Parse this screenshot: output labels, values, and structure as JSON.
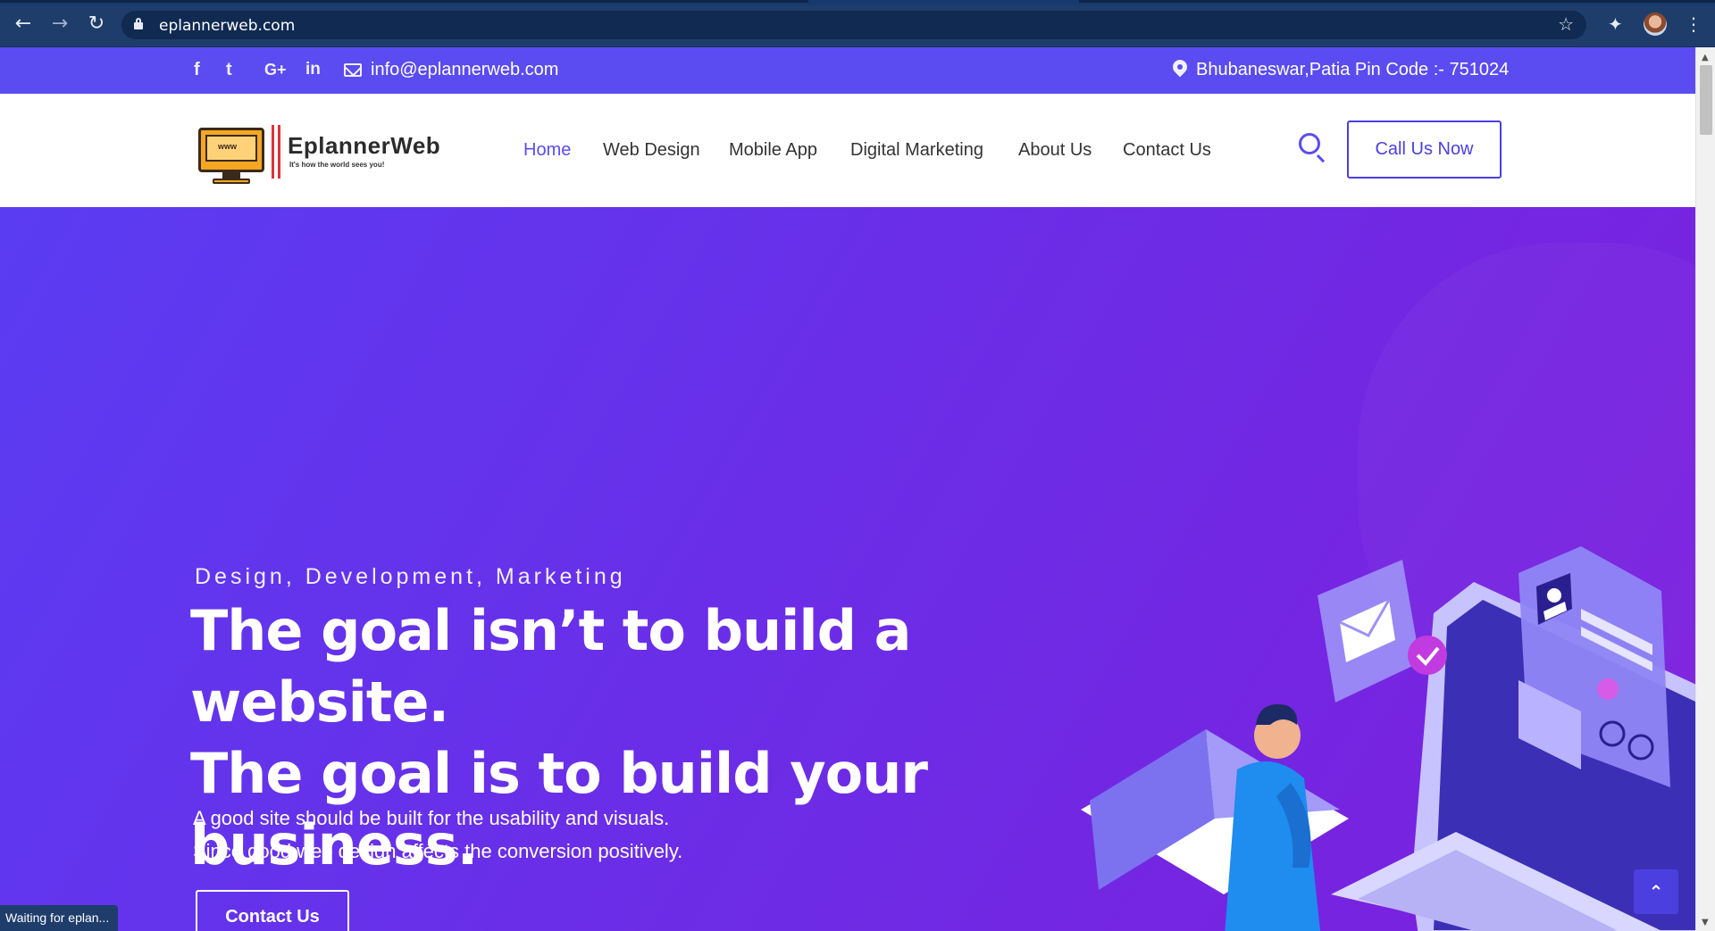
{
  "browser": {
    "url": "eplannerweb.com",
    "back_icon": "←",
    "forward_icon": "→",
    "reload_icon": "↻",
    "star_icon": "☆",
    "extensions_icon": "✦",
    "menu_icon": "⋮",
    "status_text": "Waiting for eplan..."
  },
  "topbar": {
    "facebook": "f",
    "twitter": "t",
    "googleplus": "G+",
    "linkedin": "in",
    "email": "info@eplannerweb.com",
    "address": "Bhubaneswar,Patia Pin Code :- 751024"
  },
  "header": {
    "logo_name": "EplannerWeb",
    "logo_tagline": "It's how the world sees you!",
    "menu": [
      {
        "label": "Home",
        "active": true
      },
      {
        "label": "Web Design",
        "active": false
      },
      {
        "label": "Mobile App",
        "active": false
      },
      {
        "label": "Digital Marketing",
        "active": false
      },
      {
        "label": "About Us",
        "active": false
      },
      {
        "label": "Contact Us",
        "active": false
      }
    ],
    "call_label": "Call Us Now"
  },
  "hero": {
    "eyebrow": "Design, Development, Marketing",
    "headline_line1": "The goal isn’t to build a website.",
    "headline_line2": "The goal is to build your",
    "headline_line3": "business.",
    "desc_line1": "A good site should be built for the usability and visuals.",
    "desc_line2": "Since good web design affects the conversion positively.",
    "cta_label": "Contact Us"
  },
  "back_to_top_icon": "⌃",
  "colors": {
    "brand": "#5a4cf0",
    "chrome": "#1f3d6b",
    "hero_start": "#5a3cf2",
    "hero_end": "#7d1fdc"
  }
}
